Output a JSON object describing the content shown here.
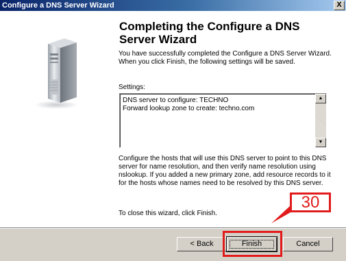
{
  "window": {
    "title": "Configure a DNS Server Wizard",
    "close_glyph": "X"
  },
  "content": {
    "heading": "Completing the Configure a DNS Server Wizard",
    "intro": "You have successfully completed the Configure a DNS Server Wizard. When you click Finish, the following settings will be saved.",
    "settings_label": "Settings:",
    "settings_lines": [
      "DNS server to configure: TECHNO",
      "Forward lookup zone to create: techno.com"
    ],
    "instructions": "Configure the hosts that will use this DNS server to point to this DNS server for name resolution, and then verify name resolution using nslookup. If you added a new primary zone, add resource records to it for the hosts whose names need to be resolved by this DNS server.",
    "closing": "To close this wizard, click Finish."
  },
  "buttons": {
    "back_label": "< Back",
    "finish_label": "Finish",
    "cancel_label": "Cancel"
  },
  "annotation": {
    "step_number": "30",
    "color": "#e11b1b"
  },
  "icons": [
    "server-tower-icon",
    "close-icon",
    "scroll-up-arrow-icon",
    "scroll-down-arrow-icon"
  ]
}
